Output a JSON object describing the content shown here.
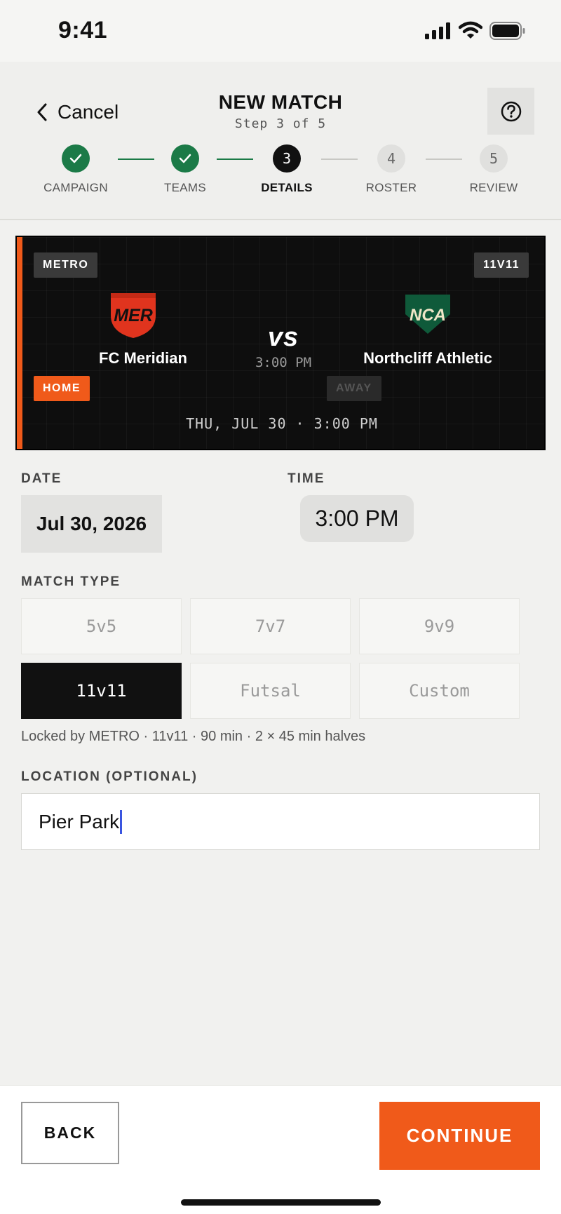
{
  "status_bar": {
    "time": "9:41"
  },
  "header": {
    "cancel_label": "Cancel",
    "title": "NEW MATCH",
    "subtitle": "Step 3 of 5",
    "help_icon": "help-circle-icon"
  },
  "steps": [
    {
      "label": "CAMPAIGN",
      "state": "done"
    },
    {
      "label": "TEAMS",
      "state": "done"
    },
    {
      "label": "DETAILS",
      "number": "3",
      "state": "current"
    },
    {
      "label": "ROSTER",
      "number": "4",
      "state": "todo"
    },
    {
      "label": "REVIEW",
      "number": "5",
      "state": "todo"
    }
  ],
  "match_card": {
    "league_chip": "METRO",
    "format_chip": "11V11",
    "home_team": {
      "crest": "MER",
      "name": "FC Meridian",
      "badge": "HOME",
      "color": "#e0341e"
    },
    "away_team": {
      "crest": "NCA",
      "name": "Northcliff Athletic",
      "badge": "AWAY",
      "color": "#0f5a3a"
    },
    "vs": "vs",
    "time": "3:00 PM",
    "date_line": "THU, JUL 30 · 3:00 PM",
    "accent_color": "#f05a1a"
  },
  "form": {
    "date_label": "DATE",
    "date_value": "Jul 30, 2026",
    "time_label": "TIME",
    "time_value": "3:00 PM",
    "match_type_label": "MATCH TYPE",
    "match_types": [
      "5v5",
      "7v7",
      "9v9",
      "11v11",
      "Futsal",
      "Custom"
    ],
    "selected_match_type": "11v11",
    "lock_note": "Locked by METRO · 11v11 · 90 min · 2 × 45 min halves",
    "location_label": "LOCATION (OPTIONAL)",
    "location_value": "Pier Park"
  },
  "footer": {
    "back_label": "BACK",
    "continue_label": "CONTINUE"
  }
}
